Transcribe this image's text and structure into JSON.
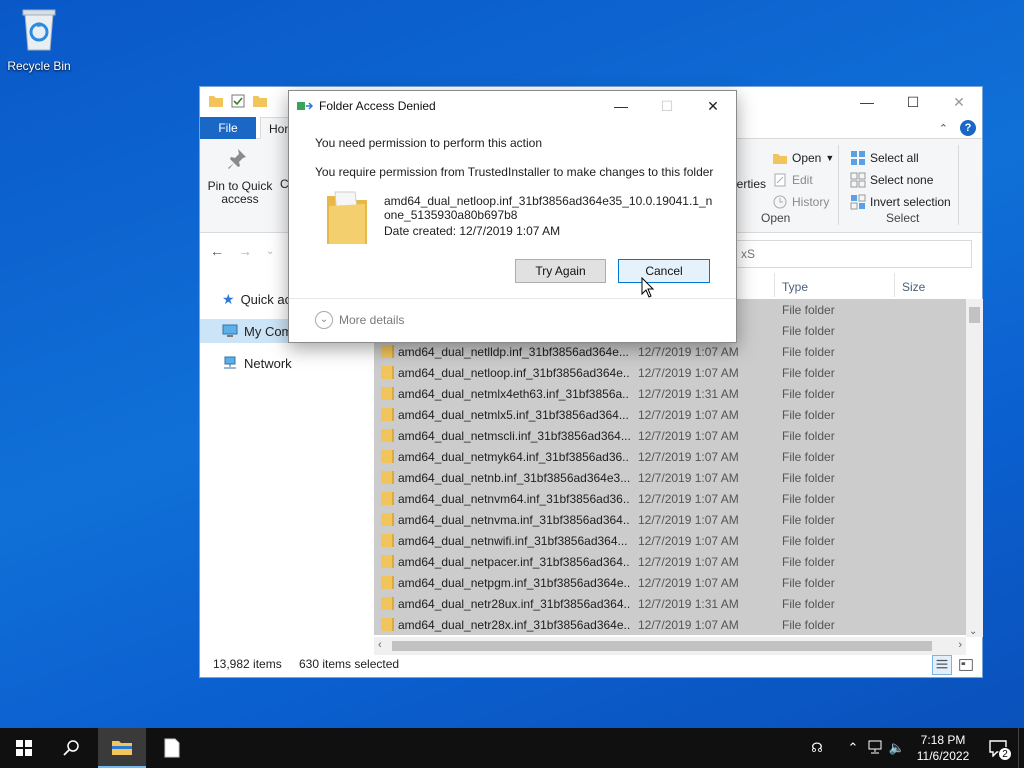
{
  "desktop": {
    "recycle_bin_label": "Recycle Bin"
  },
  "explorer": {
    "ribbon": {
      "tab_file": "File",
      "tab_home": "Hon",
      "pin_label": "Pin to Quick access",
      "copy_partial": "Co",
      "properties_partial": "perties",
      "open_label": "Open",
      "edit_label": "Edit",
      "history_label": "History",
      "open_group_label": "Open",
      "select_all": "Select all",
      "select_none": "Select none",
      "invert_selection": "Invert selection",
      "select_group_label": "Select"
    },
    "search_partial": "xS",
    "nav_pane": [
      {
        "label": "Quick ac",
        "icon": "star-icon",
        "selected": false
      },
      {
        "label": "My Com",
        "icon": "computer-icon",
        "selected": true
      },
      {
        "label": "Network",
        "icon": "network-icon",
        "selected": false
      }
    ],
    "columns": {
      "type": "Type",
      "size": "Size"
    },
    "rows": [
      {
        "name": "",
        "date": "",
        "type": "File folder"
      },
      {
        "name": "",
        "date": "",
        "type": "File folder"
      },
      {
        "name": "amd64_dual_netlldp.inf_31bf3856ad364e...",
        "date": "12/7/2019 1:07 AM",
        "type": "File folder"
      },
      {
        "name": "amd64_dual_netloop.inf_31bf3856ad364e...",
        "date": "12/7/2019 1:07 AM",
        "type": "File folder"
      },
      {
        "name": "amd64_dual_netmlx4eth63.inf_31bf3856a...",
        "date": "12/7/2019 1:31 AM",
        "type": "File folder"
      },
      {
        "name": "amd64_dual_netmlx5.inf_31bf3856ad364...",
        "date": "12/7/2019 1:07 AM",
        "type": "File folder"
      },
      {
        "name": "amd64_dual_netmscli.inf_31bf3856ad364...",
        "date": "12/7/2019 1:07 AM",
        "type": "File folder"
      },
      {
        "name": "amd64_dual_netmyk64.inf_31bf3856ad36...",
        "date": "12/7/2019 1:07 AM",
        "type": "File folder"
      },
      {
        "name": "amd64_dual_netnb.inf_31bf3856ad364e3...",
        "date": "12/7/2019 1:07 AM",
        "type": "File folder"
      },
      {
        "name": "amd64_dual_netnvm64.inf_31bf3856ad36...",
        "date": "12/7/2019 1:07 AM",
        "type": "File folder"
      },
      {
        "name": "amd64_dual_netnvma.inf_31bf3856ad364...",
        "date": "12/7/2019 1:07 AM",
        "type": "File folder"
      },
      {
        "name": "amd64_dual_netnwifi.inf_31bf3856ad364...",
        "date": "12/7/2019 1:07 AM",
        "type": "File folder"
      },
      {
        "name": "amd64_dual_netpacer.inf_31bf3856ad364...",
        "date": "12/7/2019 1:07 AM",
        "type": "File folder"
      },
      {
        "name": "amd64_dual_netpgm.inf_31bf3856ad364e...",
        "date": "12/7/2019 1:07 AM",
        "type": "File folder"
      },
      {
        "name": "amd64_dual_netr28ux.inf_31bf3856ad364...",
        "date": "12/7/2019 1:31 AM",
        "type": "File folder"
      },
      {
        "name": "amd64_dual_netr28x.inf_31bf3856ad364e...",
        "date": "12/7/2019 1:07 AM",
        "type": "File folder"
      }
    ],
    "status": {
      "item_count": "13,982 items",
      "selected_count": "630 items selected"
    }
  },
  "dialog": {
    "title": "Folder Access Denied",
    "message_1": "You need permission to perform this action",
    "message_2": "You require permission from TrustedInstaller to make changes to this folder",
    "file_name": "amd64_dual_netloop.inf_31bf3856ad364e35_10.0.19041.1_none_5135930a80b697b8",
    "date_created": "Date created: 12/7/2019 1:07 AM",
    "try_again": "Try Again",
    "cancel": "Cancel",
    "more_details": "More details"
  },
  "taskbar": {
    "time": "7:18 PM",
    "date": "11/6/2022",
    "notification_count": "2"
  },
  "colors": {
    "accent": "#0078d7",
    "file_tab": "#1a67c6",
    "selection_row": "#cccccc",
    "folder": "#f2c55c"
  }
}
